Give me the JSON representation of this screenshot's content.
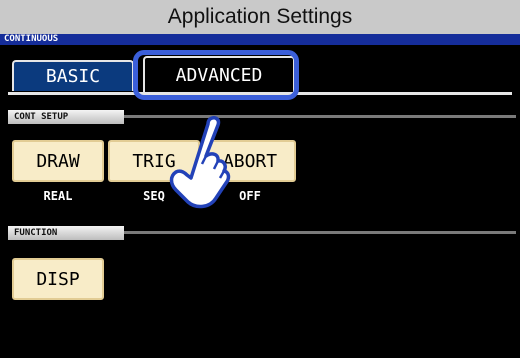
{
  "header": {
    "title": "Application Settings"
  },
  "screen": {
    "title": "CONTINUOUS",
    "tabs": [
      {
        "label": "BASIC",
        "active": false
      },
      {
        "label": "ADVANCED",
        "active": true
      }
    ],
    "cont_setup": {
      "label": "CONT SETUP",
      "buttons": [
        {
          "label": "DRAW",
          "value": "REAL"
        },
        {
          "label": "TRIG",
          "value": "SEQ"
        },
        {
          "label": "ABORT",
          "value": "OFF"
        }
      ]
    },
    "function": {
      "label": "FUNCTION",
      "buttons": [
        {
          "label": "DISP"
        }
      ]
    }
  },
  "colors": {
    "title_bar": "#152d9a",
    "tab_basic": "#0b3a7e",
    "highlight": "#3b5fd9",
    "button_face": "#f8ecc8"
  },
  "icons": {
    "pointer": "pointing-hand-icon"
  }
}
